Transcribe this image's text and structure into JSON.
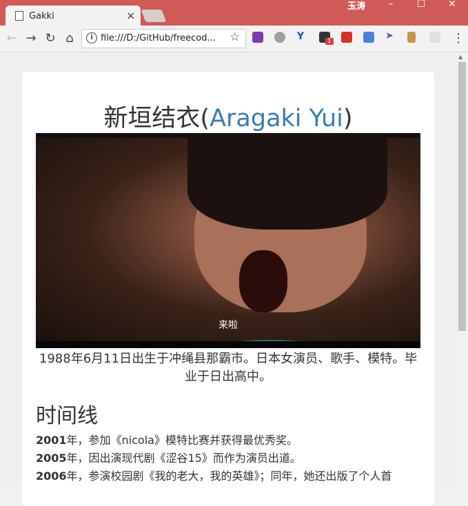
{
  "browser": {
    "tab_title": "Gakki",
    "user_name": "玉涛",
    "url": "file:///D:/GitHub/freecod...",
    "badge_count": "1"
  },
  "page": {
    "heading_cn": "新垣结衣(",
    "heading_link": "Aragaki Yui",
    "heading_close": ")",
    "image_subtitle": "来啦",
    "intro": "1988年6月11日出生于冲绳县那霸市。日本女演员、歌手、模特。毕业于日出高中。",
    "section_title": "时间线",
    "timeline": [
      {
        "year": "2001",
        "text": "年，参加《nicola》模特比赛并获得最优秀奖。"
      },
      {
        "year": "2005",
        "text": "年，因出演现代剧《涩谷15》而作为演员出道。"
      },
      {
        "year": "2006",
        "text": "年，参演校园剧《我的老大，我的英雄》；同年，她还出版了个人首"
      }
    ]
  },
  "colors": {
    "titlebar": "#cf5a57",
    "link": "#3a7ab8"
  }
}
